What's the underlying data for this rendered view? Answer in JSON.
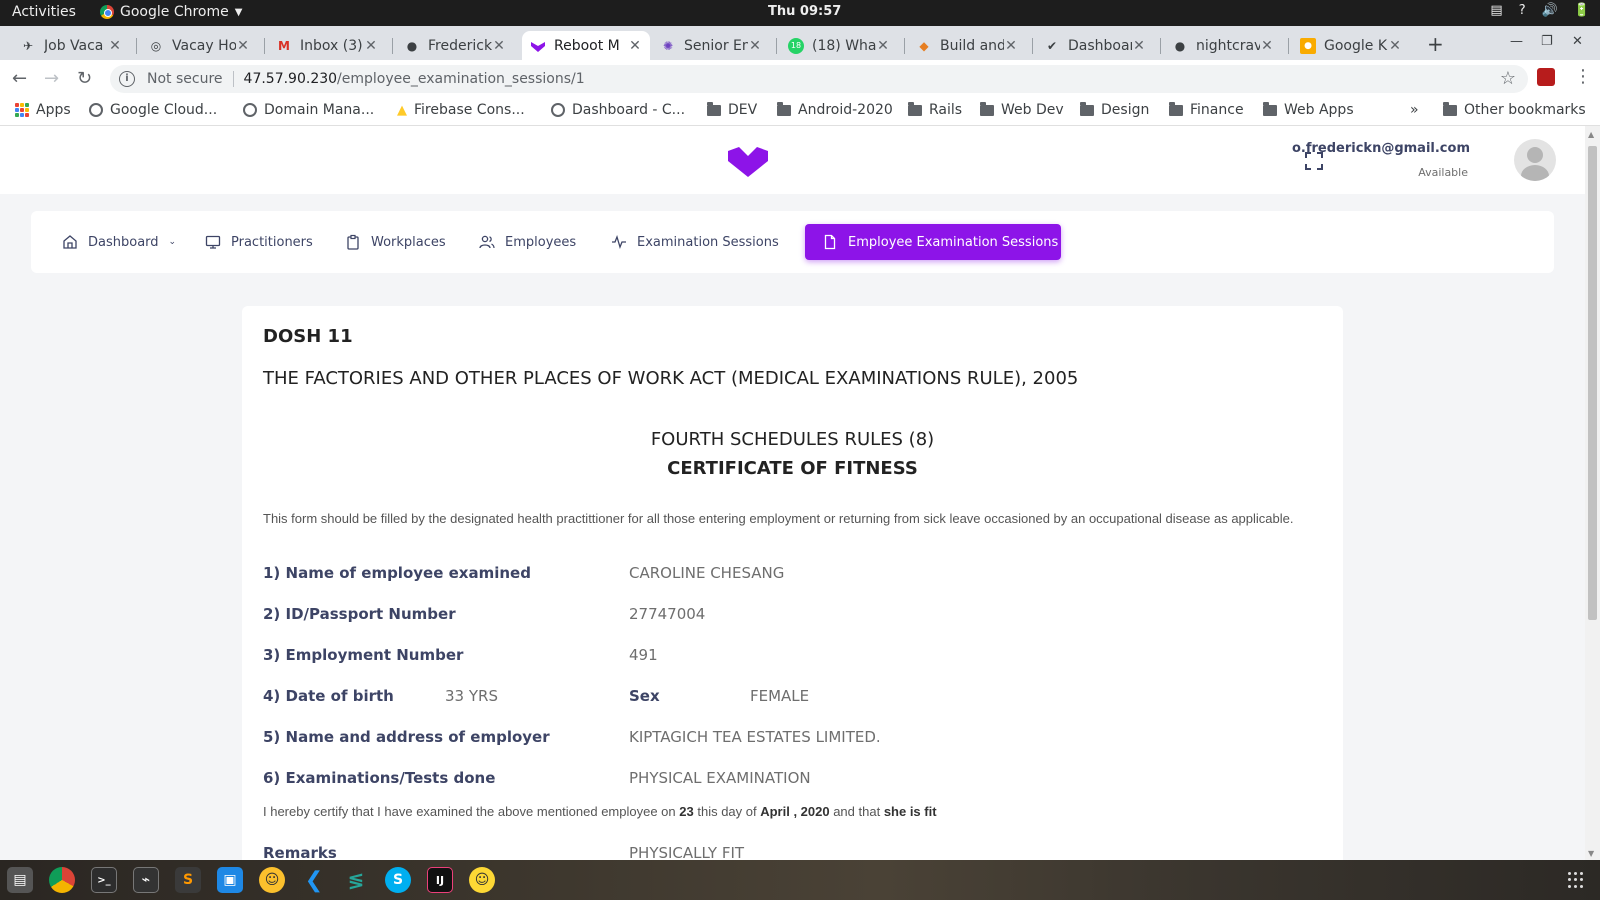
{
  "system_bar": {
    "activities": "Activities",
    "app_name": "Google Chrome",
    "clock": "Thu 09:57",
    "tray": [
      "▤",
      "?",
      "🔊",
      "🔋"
    ]
  },
  "tabs": [
    {
      "title": "Job Vaca",
      "icon": "briefcase-icon"
    },
    {
      "title": "Vacay Ho",
      "icon": "globe-icon"
    },
    {
      "title": "Inbox (3)",
      "icon": "gmail-icon"
    },
    {
      "title": "Frederick",
      "icon": "user-icon"
    },
    {
      "title": "Reboot M",
      "icon": "reboot-logo-icon",
      "active": true
    },
    {
      "title": "Senior En",
      "icon": "spinner-icon"
    },
    {
      "title": "(18) What",
      "icon": "whatsapp-icon"
    },
    {
      "title": "Build and",
      "icon": "package-icon"
    },
    {
      "title": "Dashboar",
      "icon": "check-circle-icon"
    },
    {
      "title": "nightcrav",
      "icon": "github-icon"
    },
    {
      "title": "Google K",
      "icon": "keep-icon"
    }
  ],
  "omnibox": {
    "security": "Not secure",
    "host": "47.57.90.230",
    "path": "/employee_examination_sessions/1"
  },
  "bookmarks": {
    "items": [
      {
        "label": "Apps",
        "icon": "apps-grid-icon"
      },
      {
        "label": "Google Cloud...",
        "icon": "globe-icon"
      },
      {
        "label": "Domain Mana...",
        "icon": "globe-icon"
      },
      {
        "label": "Firebase Cons...",
        "icon": "firebase-icon"
      },
      {
        "label": "Dashboard - C...",
        "icon": "globe-icon"
      },
      {
        "label": "DEV",
        "icon": "folder-icon"
      },
      {
        "label": "Android-2020",
        "icon": "folder-icon"
      },
      {
        "label": "Rails",
        "icon": "folder-icon"
      },
      {
        "label": "Web Dev",
        "icon": "folder-icon"
      },
      {
        "label": "Design",
        "icon": "folder-icon"
      },
      {
        "label": "Finance",
        "icon": "folder-icon"
      },
      {
        "label": "Web Apps",
        "icon": "folder-icon"
      }
    ],
    "overflow": "»",
    "other": "Other bookmarks"
  },
  "header": {
    "email": "o.frederickn@gmail.com",
    "status": "Available"
  },
  "nav": {
    "dashboard": "Dashboard",
    "practitioners": "Practitioners",
    "workplaces": "Workplaces",
    "employees": "Employees",
    "examination_sessions": "Examination Sessions",
    "employee_examination_sessions": "Employee Examination Sessions"
  },
  "doc": {
    "code": "DOSH 11",
    "act": "THE FACTORIES AND OTHER PLACES OF WORK ACT (MEDICAL EXAMINATIONS RULE), 2005",
    "schedule": "FOURTH SCHEDULES RULES (8)",
    "certificate": "CERTIFICATE OF FITNESS",
    "note": "This form should be filled by the designated health practittioner for all those entering employment or returning from sick leave occasioned by an occupational disease as applicable.",
    "fields": {
      "name_label": "1) Name of employee examined",
      "name_value": "CAROLINE CHESANG",
      "id_label": "2) ID/Passport Number",
      "id_value": "27747004",
      "emp_label": "3) Employment Number",
      "emp_value": "491",
      "dob_label": "4) Date of birth",
      "dob_value": "33 YRS",
      "sex_label": "Sex",
      "sex_value": "FEMALE",
      "employer_label": "5) Name and address of employer",
      "employer_value": "KIPTAGICH TEA ESTATES LIMITED.",
      "exam_label": "6) Examinations/Tests done",
      "exam_value": "PHYSICAL EXAMINATION",
      "remarks_label": "Remarks",
      "remarks_value": "PHYSICALLY FIT"
    },
    "certify": {
      "pre": "I hereby certify that I have examined the above mentioned employee on ",
      "day": "23",
      "mid1": " this day of ",
      "month": "April , 2020",
      "mid2": " and that ",
      "result": "she is fit"
    }
  },
  "colors": {
    "accent": "#8d14e8",
    "text_dark": "#3d4465",
    "text_muted": "#6e6e6e"
  }
}
